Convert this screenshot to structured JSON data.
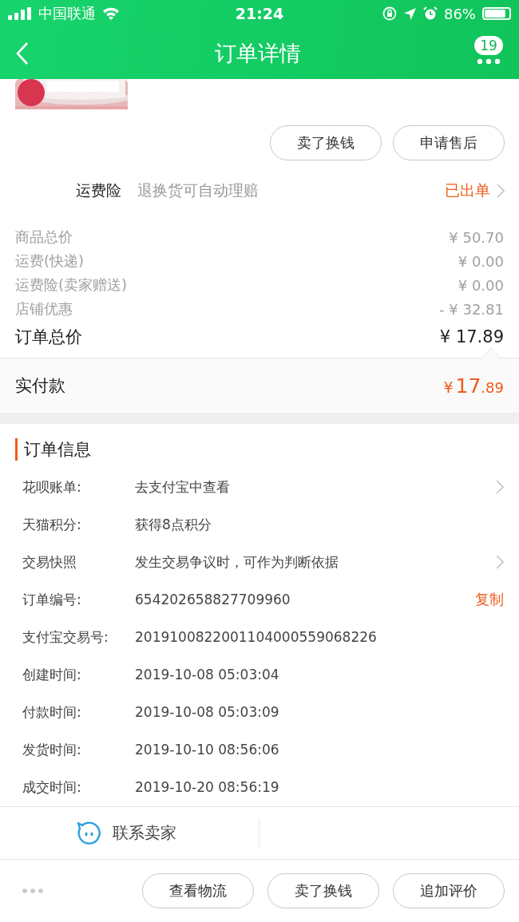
{
  "status_bar": {
    "carrier": "中国联通",
    "time": "21:24",
    "battery": "86%"
  },
  "nav": {
    "title": "订单详情",
    "badge": "19"
  },
  "product": {
    "kind": "picture"
  },
  "item_buttons": [
    "卖了换钱",
    "申请售后"
  ],
  "insurance": {
    "label": "运费险",
    "desc": "退换货可自动理赔",
    "status": "已出单"
  },
  "prices": [
    {
      "label": "商品总价",
      "value": "¥ 50.70"
    },
    {
      "label": "运费(快递)",
      "value": "¥ 0.00"
    },
    {
      "label": "运费险(卖家赠送)",
      "value": "¥ 0.00"
    },
    {
      "label": "店铺优惠",
      "value": "- ¥ 32.81"
    }
  ],
  "total": {
    "label": "订单总价",
    "value": "¥ 17.89"
  },
  "paid": {
    "label": "实付款",
    "symbol": "¥",
    "main": "17",
    "fraction": ".89"
  },
  "order_info": {
    "title": "订单信息",
    "rows": [
      {
        "label": "花呗账单:",
        "value": "去支付宝中查看",
        "chevron": true
      },
      {
        "label": "天猫积分:",
        "value": "获得8点积分",
        "chevron": false
      },
      {
        "label": "交易快照",
        "value": "发生交易争议时，可作为判断依据",
        "chevron": true
      },
      {
        "label": "订单编号:",
        "value": "654202658827709960",
        "chevron": false,
        "action": "复制"
      },
      {
        "label": "支付宝交易号:",
        "value": "2019100822001104000559068226",
        "chevron": false
      },
      {
        "label": "创建时间:",
        "value": "2019-10-08 05:03:04",
        "chevron": false
      },
      {
        "label": "付款时间:",
        "value": "2019-10-08 05:03:09",
        "chevron": false
      },
      {
        "label": "发货时间:",
        "value": "2019-10-10 08:56:06",
        "chevron": false
      },
      {
        "label": "成交时间:",
        "value": "2019-10-20 08:56:19",
        "chevron": false
      }
    ]
  },
  "contact": {
    "label": "联系卖家"
  },
  "bottom_buttons": [
    "查看物流",
    "卖了换钱",
    "追加评价"
  ]
}
